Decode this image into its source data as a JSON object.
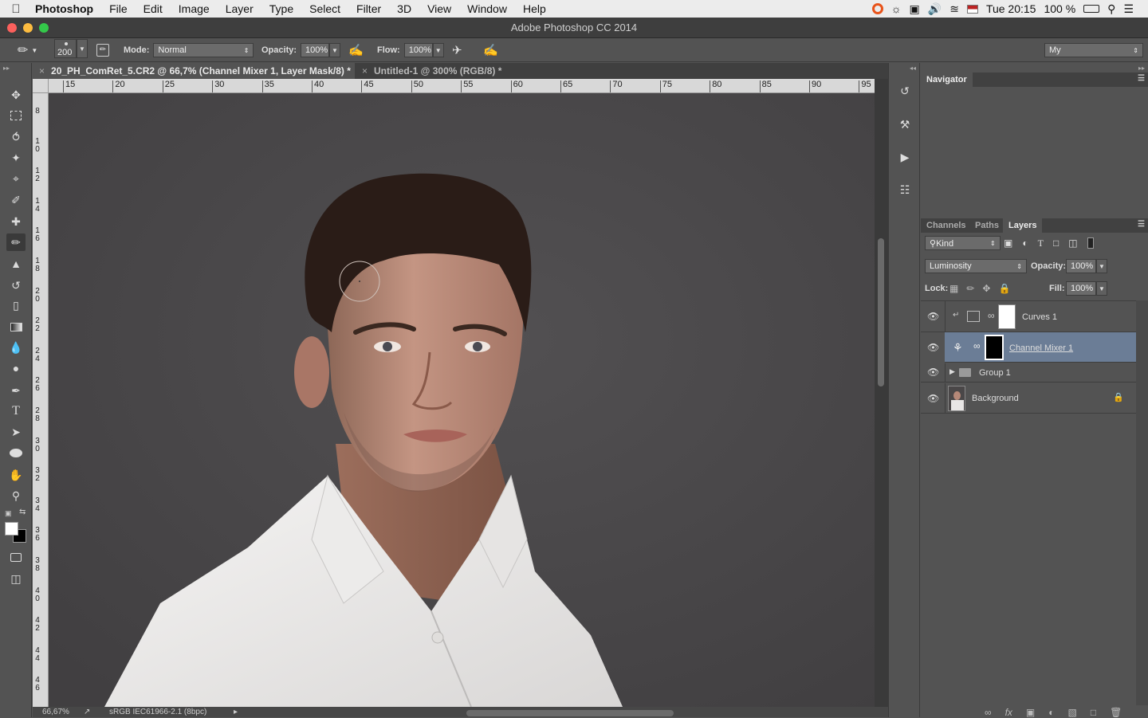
{
  "menubar": {
    "apple": "",
    "app": "Photoshop",
    "items": [
      "File",
      "Edit",
      "Image",
      "Layer",
      "Type",
      "Select",
      "Filter",
      "3D",
      "View",
      "Window",
      "Help"
    ],
    "clock": "Tue 20:15",
    "battery": "100 %"
  },
  "window": {
    "title": "Adobe Photoshop CC 2014"
  },
  "options": {
    "brush_size": "200",
    "mode_label": "Mode:",
    "mode_value": "Normal",
    "opacity_label": "Opacity:",
    "opacity_value": "100%",
    "flow_label": "Flow:",
    "flow_value": "100%",
    "workspace": "My"
  },
  "tabs": [
    {
      "label": "20_PH_ComRet_5.CR2 @ 66,7% (Channel Mixer 1, Layer Mask/8) *"
    },
    {
      "label": "Untitled-1 @ 300% (RGB/8) *"
    }
  ],
  "ruler": {
    "h_labels": [
      "15",
      "20",
      "25",
      "30",
      "35",
      "40",
      "45",
      "50",
      "55",
      "60",
      "65",
      "70",
      "75",
      "80",
      "85",
      "90",
      "95"
    ],
    "v_labels": [
      "8",
      "10",
      "12",
      "14",
      "16",
      "18",
      "20",
      "22",
      "24",
      "26",
      "28",
      "30",
      "32",
      "34",
      "36",
      "38",
      "40",
      "42",
      "44",
      "46"
    ]
  },
  "status": {
    "zoom": "66,67%",
    "profile": "sRGB IEC61966-2.1 (8bpc)"
  },
  "navigator": {
    "title": "Navigator"
  },
  "layers_panel": {
    "tabs": [
      "Channels",
      "Paths",
      "Layers"
    ],
    "active_tab": "Layers",
    "filter_kind": "Kind",
    "blend_mode": "Luminosity",
    "opacity_label": "Opacity:",
    "opacity_value": "100%",
    "lock_label": "Lock:",
    "fill_label": "Fill:",
    "fill_value": "100%",
    "layers": [
      {
        "name": "Curves 1"
      },
      {
        "name": "Channel Mixer 1"
      },
      {
        "name": "Group 1"
      },
      {
        "name": "Background"
      }
    ]
  },
  "colors": {
    "accent_selected": "#6b7d96",
    "canvas_bg": "#4a4749",
    "close": "#fc605c",
    "minimize": "#fdbc40",
    "zoom": "#34c84a"
  }
}
